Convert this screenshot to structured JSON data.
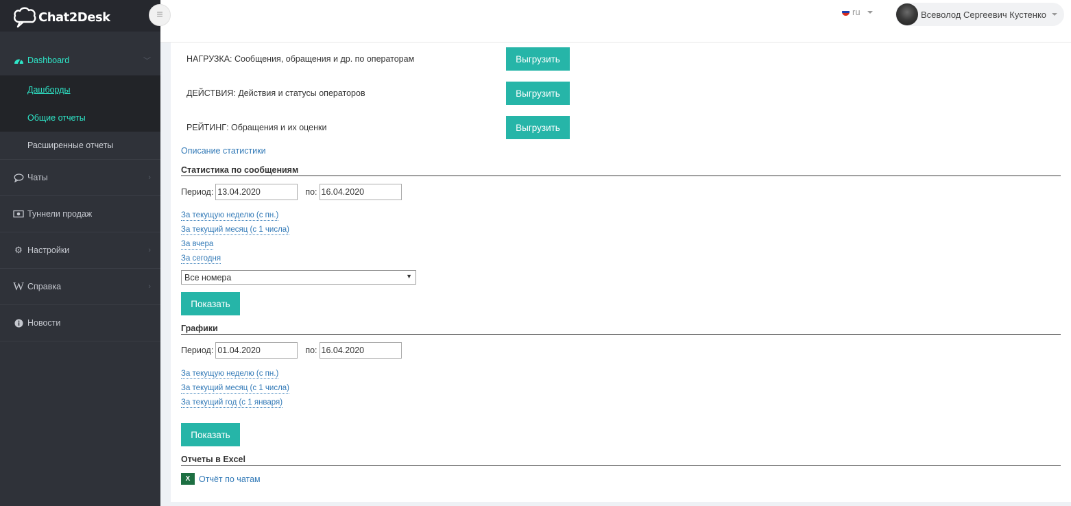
{
  "app": {
    "logo_text": "Chat2Desk"
  },
  "header": {
    "lang": "ru",
    "user_name": "Всеволод Сергеевич Кустенко",
    "flag_colors": [
      "#ffffff",
      "#1c3fae",
      "#d52b1e"
    ]
  },
  "sidebar": {
    "dashboard": {
      "label": "Dashboard",
      "icon": "dashboard-icon"
    },
    "sub_items": [
      {
        "label": "Дашборды"
      },
      {
        "label": "Общие отчеты"
      },
      {
        "label": "Расширенные отчеты"
      }
    ],
    "items": [
      {
        "label": "Чаты",
        "icon": "chat-bubble-icon"
      },
      {
        "label": "Туннели продаж",
        "icon": "money-icon"
      },
      {
        "label": "Настройки",
        "icon": "gear-icon"
      },
      {
        "label": "Справка",
        "icon": "wikipedia-icon"
      },
      {
        "label": "Новости",
        "icon": "info-icon"
      }
    ]
  },
  "exports": [
    {
      "label": "НАГРУЗКА: Сообщения, обращения и др. по операторам",
      "button": "Выгрузить"
    },
    {
      "label": "ДЕЙСТВИЯ: Действия и статусы операторов",
      "button": "Выгрузить"
    },
    {
      "label": "РЕЙТИНГ: Обращения и их оценки",
      "button": "Выгрузить"
    }
  ],
  "stats_description_link": "Описание статистики",
  "messages_stats": {
    "title": "Статистика по сообщениям",
    "period_label": "Период:",
    "to_label": "по:",
    "from": "13.04.2020",
    "to": "16.04.2020",
    "quick_links": [
      "За текущую неделю (с пн.)",
      "За текущий месяц (с 1 числа)",
      "За вчера",
      "За сегодня"
    ],
    "select_value": "Все номера",
    "show_button": "Показать"
  },
  "charts": {
    "title": "Графики",
    "period_label": "Период:",
    "to_label": "по:",
    "from": "01.04.2020",
    "to": "16.04.2020",
    "quick_links": [
      "За текущую неделю (с пн.)",
      "За текущий месяц (с 1 числа)",
      "За текущий год (с 1 января)"
    ],
    "show_button": "Показать"
  },
  "excel": {
    "title": "Отчеты в Excel",
    "link": "Отчёт по чатам",
    "icon_letter": "X"
  },
  "colors": {
    "accent": "#26b5a8",
    "sidebar_active": "#2ee6c8",
    "sidebar_bg": "#2f3239"
  }
}
